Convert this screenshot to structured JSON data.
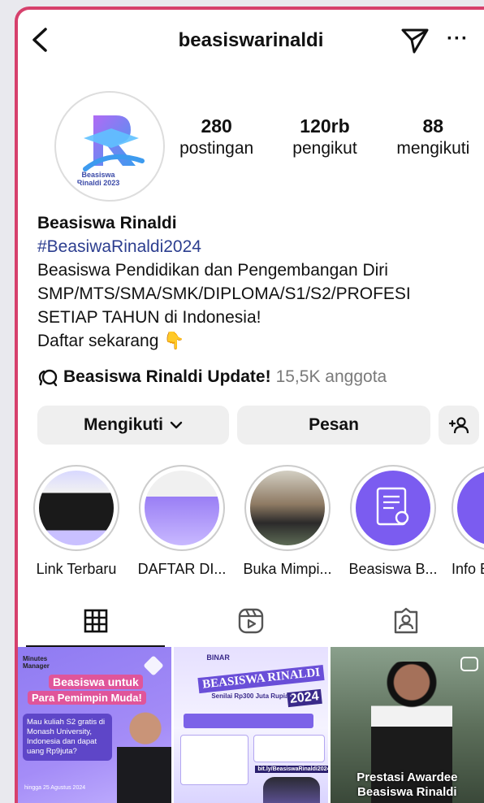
{
  "header": {
    "username": "beasiswarinaldi"
  },
  "profile": {
    "avatar_text_line1": "Beasiswa",
    "avatar_text_line2": "Rinaldi 2023",
    "stats": [
      {
        "value": "280",
        "label": "postingan"
      },
      {
        "value": "120rb",
        "label": "pengikut"
      },
      {
        "value": "88",
        "label": "mengikuti"
      }
    ],
    "name": "Beasiswa Rinaldi",
    "hashtag": "#BeasiwaRinaldi2024",
    "bio_lines": [
      "Beasiswa Pendidikan dan Pengembangan Diri",
      "SMP/MTS/SMA/SMK/DIPLOMA/S1/S2/PROFESI",
      "SETIAP TAHUN di Indonesia!",
      "Daftar sekarang 👇"
    ],
    "community_name": "Beasiswa Rinaldi Update!",
    "community_count": "15,5K anggota"
  },
  "buttons": {
    "follow": "Mengikuti",
    "message": "Pesan"
  },
  "highlights": [
    {
      "label": "Link Terbaru"
    },
    {
      "label": "DAFTAR DI..."
    },
    {
      "label": "Buka Mimpi..."
    },
    {
      "label": "Beasiswa B..."
    },
    {
      "label": "Info B"
    }
  ],
  "posts": [
    {
      "brand": "Minutes Manager",
      "title1": "Beasiswa untuk",
      "title2": "Para Pemimpin Muda!",
      "body": "Mau kuliah S2 gratis di Monash University, Indonesia dan dapat uang Rp9juta?",
      "deadline": "hingga 25 Agustus 2024"
    },
    {
      "brand": "BINAR",
      "title": "BEASISWA RINALDI",
      "year": "2024",
      "subtitle": "Senilai Rp300 Juta Rupiah",
      "link": "bit.ly/BeasiswaRinaldi2024"
    },
    {
      "caption1": "Prestasi Awardee",
      "caption2": "Beasiswa Rinaldi"
    }
  ],
  "colors": {
    "accent": "#d6406c",
    "brand_purple": "#7b5cf0",
    "hashtag": "#2c3e8f"
  }
}
